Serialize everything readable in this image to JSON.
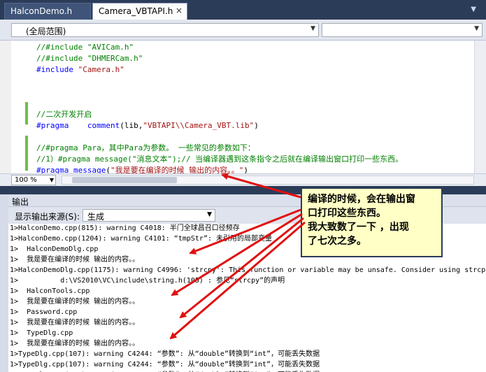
{
  "tabs": [
    {
      "label": "HalconDemo.h",
      "active": false
    },
    {
      "label": "Camera_VBTAPI.h",
      "active": true,
      "close": "×"
    }
  ],
  "scope": {
    "value": "(全局范围)"
  },
  "editor": {
    "lines": [
      {
        "parts": [
          {
            "t": "//#include \"AVICam.h\"",
            "c": "c-comment"
          }
        ]
      },
      {
        "parts": [
          {
            "t": "//#include \"DHMERCam.h\"",
            "c": "c-comment"
          }
        ]
      },
      {
        "parts": [
          {
            "t": "#include ",
            "c": "c-pp"
          },
          {
            "t": "\"Camera.h\"",
            "c": "c-str"
          }
        ]
      },
      {
        "parts": []
      },
      {
        "parts": []
      },
      {
        "parts": []
      },
      {
        "parts": [
          {
            "t": "//二次开发开启",
            "c": "c-comment"
          }
        ]
      },
      {
        "parts": [
          {
            "t": "#pragma",
            "c": "c-pp"
          },
          {
            "t": "    comment",
            "c": "c-pp"
          },
          {
            "t": "(lib,",
            "c": "c-fn"
          },
          {
            "t": "\"VBTAPI\\\\Camera_VBT.lib\"",
            "c": "c-str"
          },
          {
            "t": ")",
            "c": "c-fn"
          }
        ]
      },
      {
        "parts": []
      },
      {
        "parts": [
          {
            "t": "//#pragma Para，其中Para为参数。 一些常见的参数如下：",
            "c": "c-comment"
          }
        ]
      },
      {
        "parts": [
          {
            "t": "//1）#pragma message(\"消息文本\");// 当编译器遇到这条指令之后就在编译输出窗口打印一些东西。",
            "c": "c-comment"
          }
        ]
      },
      {
        "parts": [
          {
            "t": "#pragma",
            "c": "c-pp"
          },
          {
            "t": " message",
            "c": "c-pp"
          },
          {
            "t": "(",
            "c": "c-fn"
          },
          {
            "t": "\"我是要在编译的时候 输出的内容。。\"",
            "c": "c-str"
          },
          {
            "t": ")",
            "c": "c-fn"
          }
        ]
      }
    ]
  },
  "zoom": {
    "value": "100 %"
  },
  "output": {
    "title": "输出",
    "source_label": "显示输出来源(S):",
    "source_value": "生成",
    "lines": [
      "1>HalconDemo.cpp(815): warning C4018: 半门全球昌召口径频存",
      "1>HalconDemo.cpp(1204): warning C4101: “tmpStr”: 未引用的局部变量",
      "1>  HalconDemoDlg.cpp",
      "1>  我是要在编译的时候 输出的内容。。",
      "1>HalconDemoDlg.cpp(1175): warning C4996: 'strcpy': This function or variable may be unsafe. Consider using strcpy_s",
      "1>          d:\\VS2010\\VC\\include\\string.h(105) : 参见“strcpy”的声明",
      "1>  HalconTools.cpp",
      "1>  我是要在编译的时候 输出的内容。。",
      "1>  Password.cpp",
      "1>  我是要在编译的时候 输出的内容。。",
      "1>  TypeDlg.cpp",
      "1>  我是要在编译的时候 输出的内容。。",
      "1>TypeDlg.cpp(107): warning C4244: “参数”: 从“double”转换到“int”，可能丢失数据",
      "1>TypeDlg.cpp(107): warning C4244: “参数”: 从“double”转换到“int”，可能丢失数据",
      "1>TypeDlg.cpp(111): warning C4244: “参数”: 从“double”转换到“int”，可能丢失数据"
    ]
  },
  "callout": {
    "lines": [
      "编译的时候，会在输出窗",
      "口打印这些东西。",
      "我大致数了一下 ，出现",
      "了七次之多。"
    ]
  },
  "colors": {
    "arrow": "#e01010",
    "callout_bg": "#ffffc6",
    "frame": "#2b3c59"
  }
}
